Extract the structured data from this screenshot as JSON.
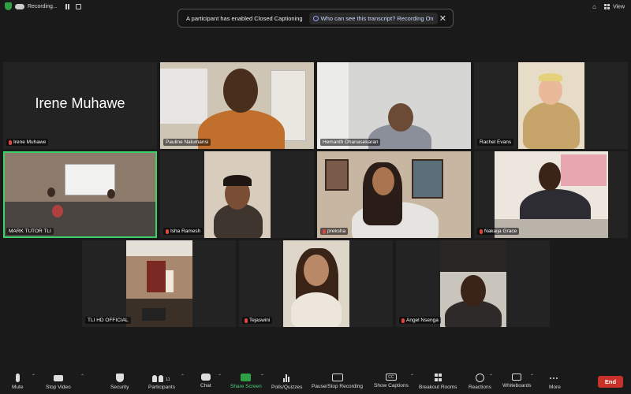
{
  "top_bar": {
    "recording_label": "Recording...",
    "view_label": "View"
  },
  "caption_banner": {
    "message": "A participant has enabled Closed Captioning",
    "link_label": "Who can see this transcript? Recording On"
  },
  "participants": [
    {
      "name": "Irene Muhawe",
      "display_text": "Irene Muhawe",
      "muted": true
    },
    {
      "name": "Pauline Nalumansi",
      "muted": false
    },
    {
      "name": "Hemanth Dhanasekaran",
      "muted": false
    },
    {
      "name": "Rachel Evans",
      "muted": false
    },
    {
      "name": "MARK TUTOR TLI",
      "muted": false,
      "active_speaker": true
    },
    {
      "name": "Isha Ramesh",
      "muted": true
    },
    {
      "name": "preksha",
      "muted": true
    },
    {
      "name": "Nakaija Grace",
      "muted": true
    },
    {
      "name": "TLI HD OFFICIAL",
      "muted": false
    },
    {
      "name": "Tejaswini",
      "muted": true
    },
    {
      "name": "Angel Nsenga",
      "muted": true
    }
  ],
  "toolbar": {
    "mute": "Mute",
    "stop_video": "Stop Video",
    "security": "Security",
    "participants": "Participants",
    "participants_count": "11",
    "chat": "Chat",
    "share_screen": "Share Screen",
    "polls": "Polls/Quizzes",
    "pause_recording": "Pause/Stop Recording",
    "show_captions": "Show Captions",
    "cc_glyph": "CC",
    "breakout": "Breakout Rooms",
    "reactions": "Reactions",
    "whiteboards": "Whiteboards",
    "more": "More",
    "end": "End"
  },
  "colors": {
    "active_border": "#3ecf6b",
    "end_button": "#c8322a",
    "share_green": "#2ea043",
    "mute_red": "#e0463c"
  }
}
